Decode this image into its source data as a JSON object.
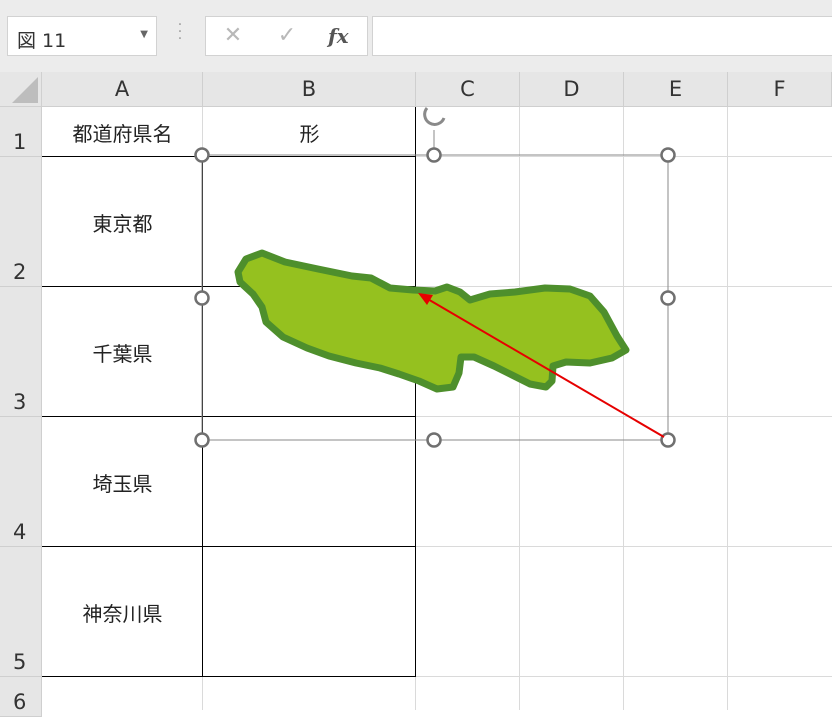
{
  "name_box": {
    "value": "図 11"
  },
  "formula_bar": {
    "cancel_symbol": "✕",
    "enter_symbol": "✓",
    "fx_symbol": "fx",
    "content": ""
  },
  "columns": [
    "A",
    "B",
    "C",
    "D",
    "E",
    "F"
  ],
  "rows": [
    "1",
    "2",
    "3",
    "4",
    "5",
    "6"
  ],
  "table": {
    "headers": [
      "都道府県名",
      "形"
    ],
    "prefectures": [
      "東京都",
      "千葉県",
      "埼玉県",
      "神奈川県"
    ]
  },
  "colors": {
    "ribbon_bg": "#ececec",
    "header_bg": "#e6e6e6",
    "gridline": "#dadada",
    "handle": "#707070",
    "arrow": "#e60000",
    "shape_fill": "#95c11f",
    "shape_border": "#4e8f2c"
  },
  "icons": [
    "dropdown-caret-icon",
    "cancel-icon",
    "enter-check-icon",
    "function-icon",
    "rotation-handle-icon"
  ]
}
